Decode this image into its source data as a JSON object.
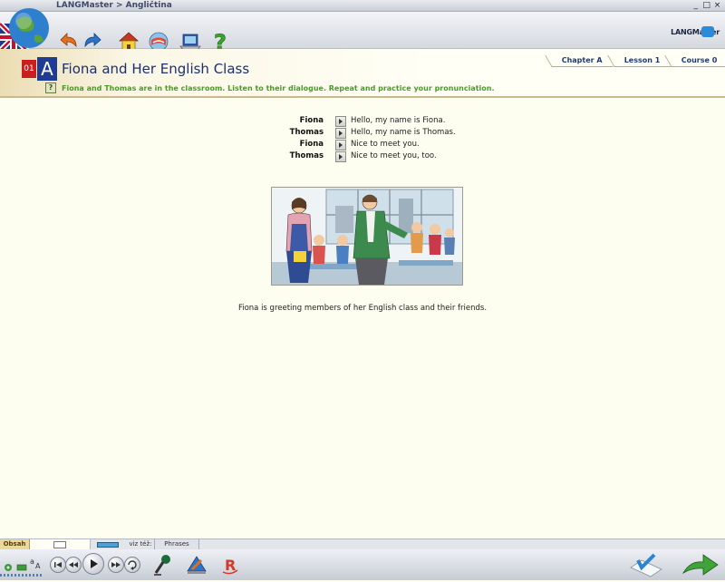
{
  "window": {
    "title": "LANGMaster > Angličtina",
    "controls": [
      "_",
      "□",
      "×"
    ]
  },
  "brand": {
    "name": "LANGMaster"
  },
  "toolbar": {
    "buttons": [
      {
        "name": "back",
        "icon": "back-arrow-icon"
      },
      {
        "name": "forward",
        "icon": "forward-arrow-icon"
      },
      {
        "name": "home",
        "icon": "home-icon"
      },
      {
        "name": "dictionary",
        "icon": "dictionary-icon"
      },
      {
        "name": "lab",
        "icon": "laptop-icon"
      },
      {
        "name": "help",
        "icon": "help-icon"
      }
    ]
  },
  "breadcrumbs": [
    {
      "label": "Chapter A"
    },
    {
      "label": "Lesson 1"
    },
    {
      "label": "Course 0"
    }
  ],
  "lesson": {
    "number": "01",
    "letter": "A",
    "title": "Fiona and Her English Class",
    "help_icon_glyph": "?",
    "instruction": "Fiona and Thomas are in the classroom. Listen to their dialogue. Repeat and practice your pronunciation."
  },
  "dialogue": [
    {
      "speaker": "Fiona",
      "text": "Hello, my name is Fiona."
    },
    {
      "speaker": "Thomas",
      "text": "Hello, my name is Thomas."
    },
    {
      "speaker": "Fiona",
      "text": "Nice to meet you."
    },
    {
      "speaker": "Thomas",
      "text": "Nice to meet you, too."
    }
  ],
  "caption": "Fiona is greeting members of her English class and their friends.",
  "bottom_tabs": {
    "obsah": "Obsah",
    "see_also": "viz též:",
    "phrases": "Phrases"
  },
  "colors": {
    "accent_blue": "#1b2f70",
    "instruction_green": "#4a9a2a",
    "lesson_red": "#c91f1f",
    "tab_text": "#1f3a7a"
  }
}
